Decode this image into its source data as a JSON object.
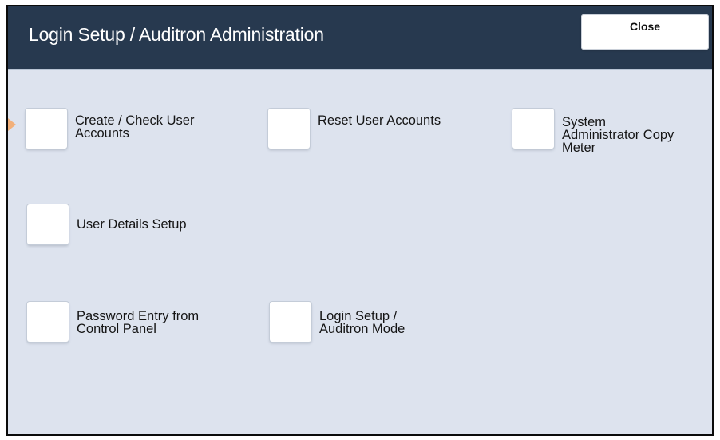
{
  "header": {
    "title": "Login Setup / Auditron Administration",
    "close_label": "Close"
  },
  "options": [
    {
      "label_lines": [
        "Create / Check User",
        "Accounts"
      ]
    },
    {
      "label_lines": [
        "Reset User Accounts"
      ]
    },
    {
      "label_lines": [
        "System",
        "Administrator Copy",
        "Meter"
      ]
    },
    {
      "label_lines": [
        "User Details Setup"
      ]
    },
    {
      "label_lines": [
        "Password Entry from",
        "Control Panel"
      ]
    },
    {
      "label_lines": [
        "Login Setup /",
        "Auditron Mode"
      ]
    }
  ],
  "colors": {
    "header_bg": "#27394f",
    "panel_bg": "#dde3ee",
    "checkbox_bg": "#ffffff"
  }
}
